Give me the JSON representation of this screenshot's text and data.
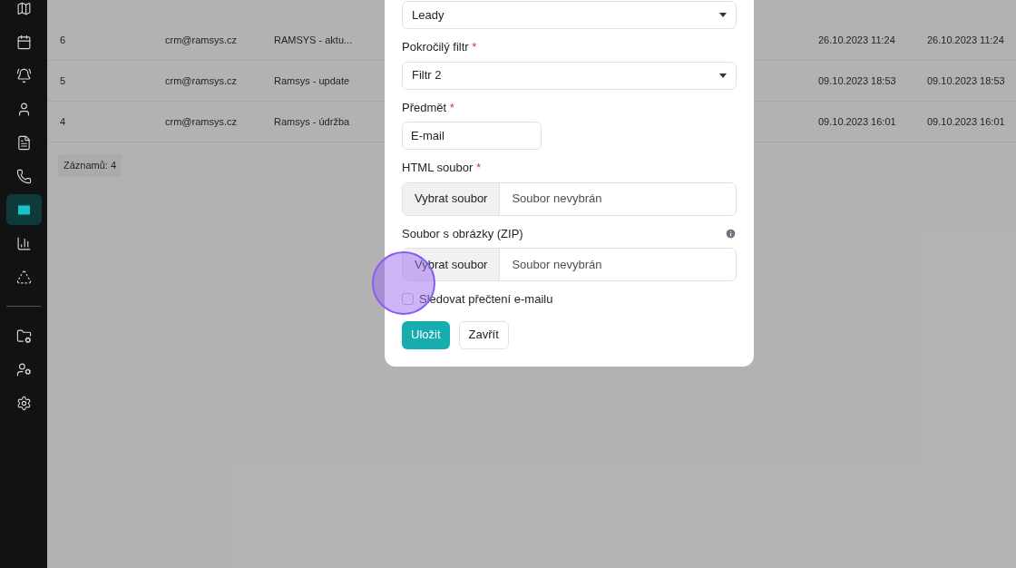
{
  "sidebar": {
    "items": [
      {
        "selected": false
      },
      {
        "selected": false
      },
      {
        "selected": false
      },
      {
        "selected": false
      },
      {
        "selected": false
      },
      {
        "selected": false
      },
      {
        "selected": true
      },
      {
        "selected": false
      },
      {
        "selected": false
      }
    ],
    "bottom_items": [
      {
        "selected": false
      },
      {
        "selected": false
      },
      {
        "selected": false
      }
    ]
  },
  "table": {
    "rows": [
      [
        "6",
        "crm@ramsys.cz",
        "RAMSYS - aktu...",
        "26.10.2023 11:24",
        "26.10.2023 11:24"
      ],
      [
        "5",
        "crm@ramsys.cz",
        "Ramsys - update",
        "09.10.2023 18:53",
        "09.10.2023 18:53"
      ],
      [
        "4",
        "crm@ramsys.cz",
        "Ramsys - údržba",
        "09.10.2023 16:01",
        "09.10.2023 16:01"
      ]
    ],
    "footer": "Záznamů: 4"
  },
  "modal": {
    "fields": [
      {
        "kind": "select",
        "value": "Leady"
      },
      {
        "kind": "select",
        "label": "Pokročilý filtr",
        "required_mark": "*",
        "value": "Filtr 2"
      },
      {
        "kind": "text",
        "label": "Předmět",
        "required_mark": "*",
        "value": "E-mail"
      },
      {
        "kind": "file",
        "label": "HTML soubor",
        "required_mark": "*",
        "button": "Vybrat soubor",
        "value": "Soubor nevybrán"
      },
      {
        "kind": "file",
        "label": "Soubor s obrázky (ZIP)",
        "info": true,
        "button": "Vybrat soubor",
        "value": "Soubor nevybrán"
      },
      {
        "kind": "checkbox",
        "label": "Sledovat přečtení e-mailu",
        "checked": false
      }
    ],
    "buttons": [
      {
        "label": "Uložit",
        "kind": "primary"
      },
      {
        "label": "Zavřít",
        "kind": "secondary"
      }
    ]
  }
}
